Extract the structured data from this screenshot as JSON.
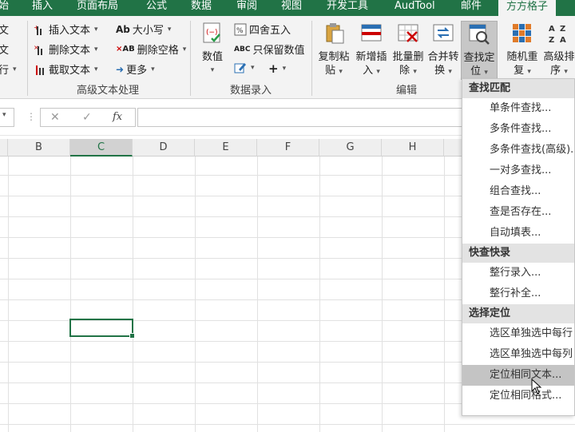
{
  "tabs": [
    {
      "label": "始",
      "active": false
    },
    {
      "label": "插入",
      "active": false
    },
    {
      "label": "页面布局",
      "active": false
    },
    {
      "label": "公式",
      "active": false
    },
    {
      "label": "数据",
      "active": false
    },
    {
      "label": "审阅",
      "active": false
    },
    {
      "label": "视图",
      "active": false
    },
    {
      "label": "开发工具",
      "active": false
    },
    {
      "label": "AudTool",
      "active": false
    },
    {
      "label": "邮件",
      "active": false
    },
    {
      "label": "方方格子",
      "active": true
    }
  ],
  "ribbon": {
    "left_partial": [
      "文",
      "文",
      "行"
    ],
    "text_group": {
      "insert_text": "插入文本",
      "delete_text": "删除文本",
      "cut_text": "截取文本",
      "case": "大小写",
      "delete_space": "删除空格",
      "more": "更多",
      "label": "高级文本处理"
    },
    "number_group": {
      "value_label_1": "数值",
      "round": "四舍五入",
      "keep_value": "只保留数值",
      "plus": "+",
      "label": "数据录入"
    },
    "edit_group": {
      "copy_paste": [
        "复制粘",
        "贴"
      ],
      "add_insert": [
        "新增插",
        "入"
      ],
      "batch_delete": [
        "批量删",
        "除"
      ],
      "merge_convert": [
        "合并转",
        "换"
      ],
      "find_locate": [
        "查找定",
        "位"
      ],
      "label": "编辑"
    },
    "right_group": {
      "random_repeat": [
        "随机重",
        "复"
      ],
      "advanced_sort": [
        "高级排",
        "序"
      ]
    }
  },
  "formula_bar": {
    "cancel_symbol": "✕",
    "enter_symbol": "✓",
    "fx_symbol": "fx"
  },
  "grid": {
    "columns": [
      "B",
      "C",
      "D",
      "E",
      "F",
      "G",
      "H"
    ],
    "selected_column": "C"
  },
  "menu": {
    "sections": [
      {
        "header": "查找匹配",
        "items": [
          "单条件查找...",
          "多条件查找...",
          "多条件查找(高级)...",
          "一对多查找...",
          "组合查找...",
          "查是否存在...",
          "自动填表..."
        ]
      },
      {
        "header": "快查快录",
        "items": [
          "整行录入...",
          "整行补全..."
        ]
      },
      {
        "header": "选择定位",
        "items": [
          "选区单独选中每行",
          "选区单独选中每列",
          "定位相同文本...",
          "定位相同格式..."
        ]
      }
    ],
    "highlighted": "定位相同文本..."
  },
  "colors": {
    "excel_green": "#217346",
    "ribbon_bg": "#f3f3f3",
    "menu_header_bg": "#e3e3e3",
    "menu_highlight": "#c4c4c4"
  }
}
